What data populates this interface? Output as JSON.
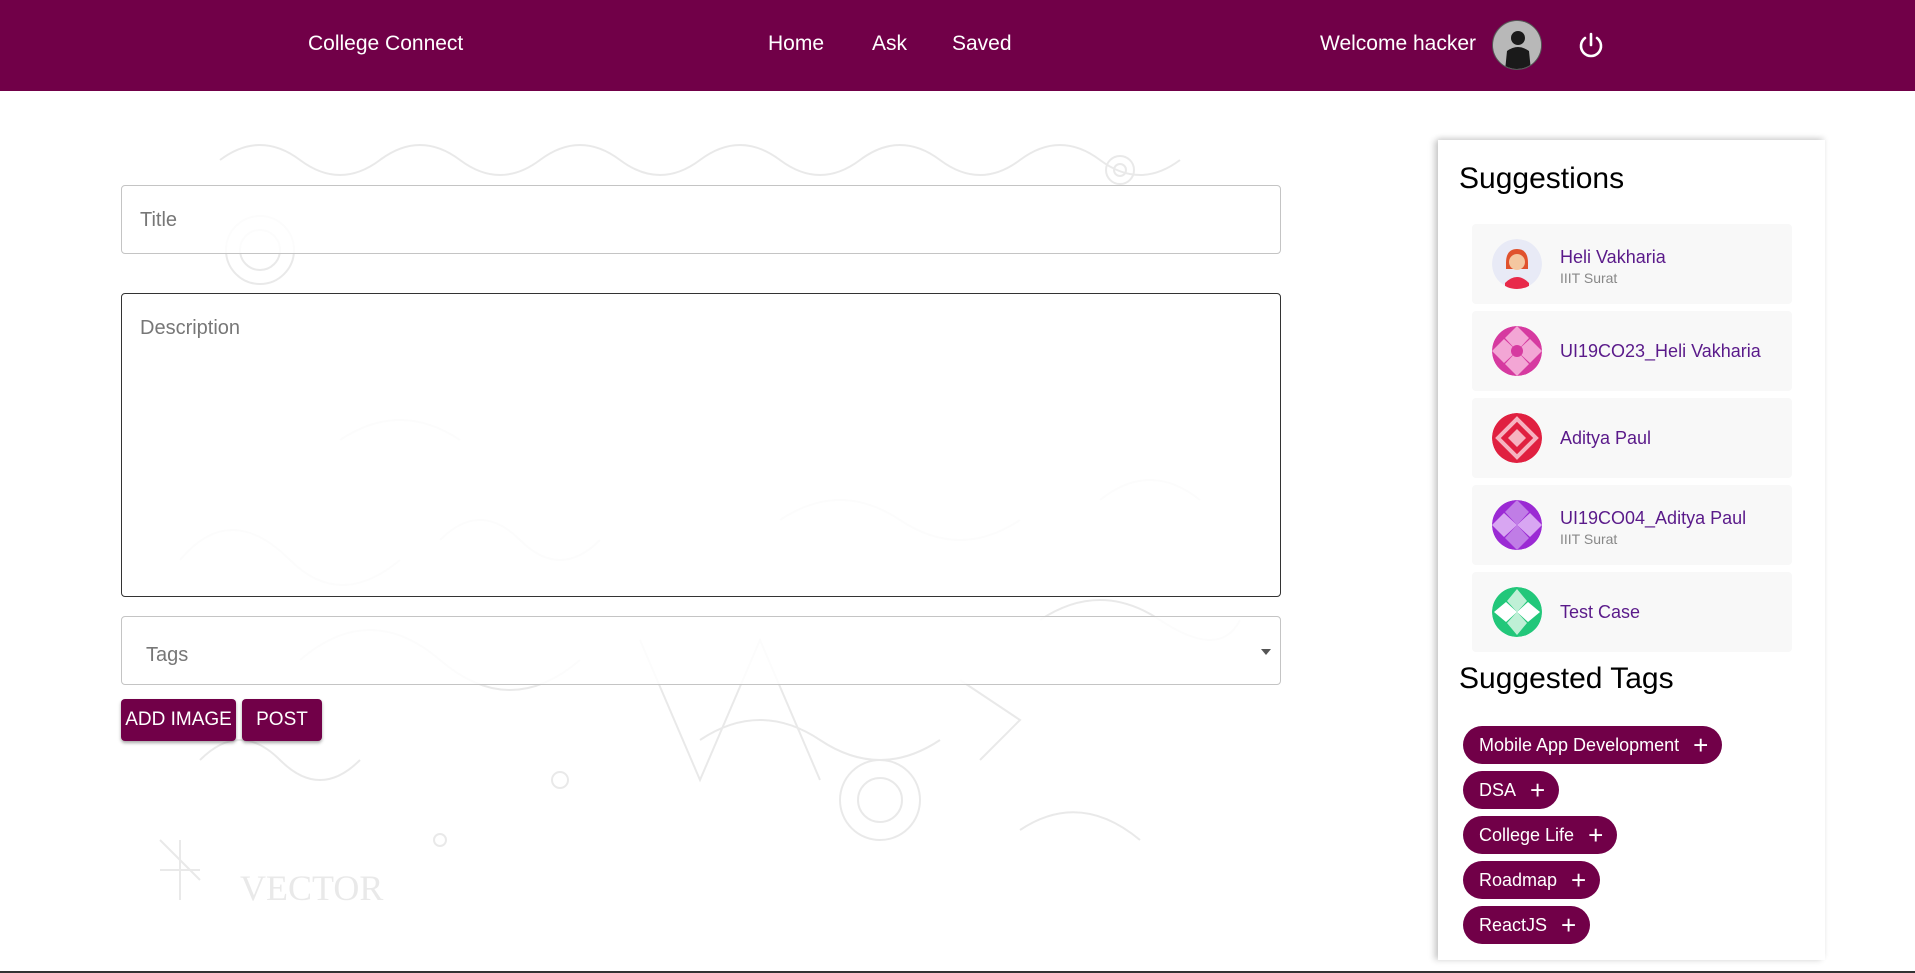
{
  "header": {
    "brand": "College Connect",
    "nav": {
      "home": "Home",
      "ask": "Ask",
      "saved": "Saved"
    },
    "welcome": "Welcome hacker",
    "bg_color": "#710048"
  },
  "form": {
    "title_placeholder": "Title",
    "description_placeholder": "Description",
    "tags_placeholder": "Tags",
    "add_image_label": "ADD IMAGE",
    "post_label": "POST"
  },
  "sidebar": {
    "suggestions_heading": "Suggestions",
    "suggestions": [
      {
        "name": "Heli Vakharia",
        "subtitle": "IIIT Surat",
        "avatar_color": "#e8eaf6"
      },
      {
        "name": "UI19CO23_Heli Vakharia",
        "subtitle": "",
        "avatar_color": "#d63aa0"
      },
      {
        "name": "Aditya Paul",
        "subtitle": "",
        "avatar_color": "#e02040"
      },
      {
        "name": "UI19CO04_Aditya Paul",
        "subtitle": "IIIT Surat",
        "avatar_color": "#9b2ad4"
      },
      {
        "name": "Test Case",
        "subtitle": "",
        "avatar_color": "#22c77a"
      }
    ],
    "tags_heading": "Suggested Tags",
    "tags": [
      {
        "label": "Mobile App Development",
        "plus": "+"
      },
      {
        "label": "DSA",
        "plus": "+"
      },
      {
        "label": "College Life",
        "plus": "+"
      },
      {
        "label": "Roadmap",
        "plus": "+"
      },
      {
        "label": "ReactJS",
        "plus": "+"
      }
    ]
  }
}
